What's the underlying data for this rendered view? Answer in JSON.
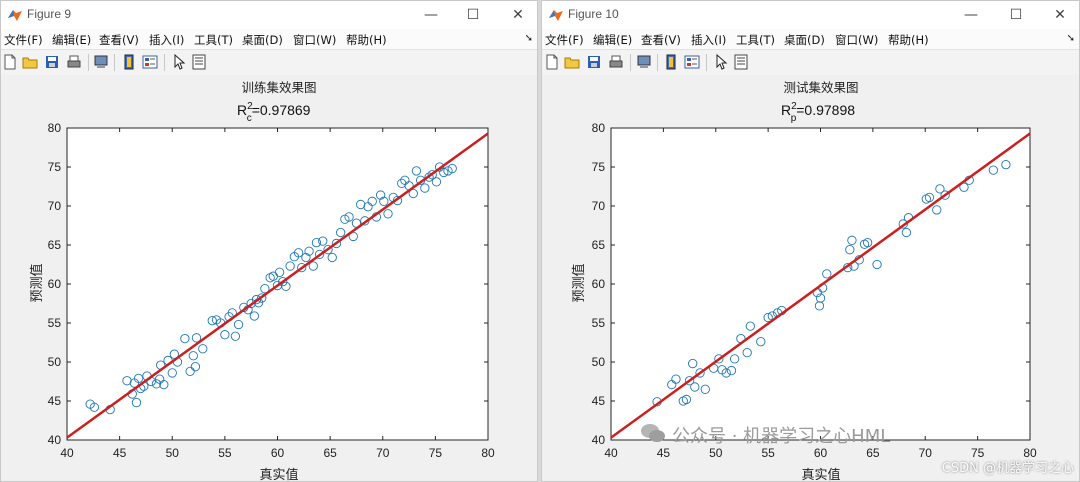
{
  "windows": [
    {
      "title": "Figure 9",
      "menu": [
        "文件(F)",
        "编辑(E)",
        "查看(V)",
        "插入(I)",
        "工具(T)",
        "桌面(D)",
        "窗口(W)",
        "帮助(H)"
      ],
      "plot": {
        "title": "训练集效果图",
        "metric_main": "R",
        "metric_sup": "2",
        "metric_sub": "c",
        "metric_value": "=0.97869",
        "xlabel": "真实值",
        "ylabel": "预测值"
      }
    },
    {
      "title": "Figure 10",
      "menu": [
        "文件(F)",
        "编辑(E)",
        "查看(V)",
        "插入(I)",
        "工具(T)",
        "桌面(D)",
        "窗口(W)",
        "帮助(H)"
      ],
      "plot": {
        "title": "测试集效果图",
        "metric_main": "R",
        "metric_sup": "2",
        "metric_sub": "p",
        "metric_value": "=0.97898",
        "xlabel": "真实值",
        "ylabel": "预测值"
      }
    }
  ],
  "watermark": "公众号 · 机器学习之心HML",
  "credit": "CSDN @机器学习之心",
  "colors": {
    "marker": "#1f77b4",
    "fit_line": "#cc1f1f",
    "axes_bg": "#ffffff"
  },
  "icons": [
    "new-file-icon",
    "open-folder-icon",
    "save-icon",
    "print-icon",
    "print-preview-icon",
    "link-plot-icon",
    "property-inspector-icon",
    "pointer-icon",
    "edit-plot-icon"
  ],
  "chart_data": [
    {
      "type": "scatter",
      "title": "训练集效果图",
      "annotation": "Rc²=0.97869",
      "xlabel": "真实值",
      "ylabel": "预测值",
      "xlim": [
        40,
        80
      ],
      "ylim": [
        40,
        80
      ],
      "xticks": [
        40,
        45,
        50,
        55,
        60,
        65,
        70,
        75,
        80
      ],
      "yticks": [
        40,
        45,
        50,
        55,
        60,
        65,
        70,
        75,
        80
      ],
      "grid": false,
      "fit_line": [
        [
          40,
          40.3
        ],
        [
          80,
          79.3
        ]
      ],
      "points": [
        [
          42.2,
          44.6
        ],
        [
          42.6,
          44.2
        ],
        [
          44.1,
          43.9
        ],
        [
          45.7,
          47.6
        ],
        [
          46.2,
          45.9
        ],
        [
          46.4,
          47.3
        ],
        [
          46.6,
          44.8
        ],
        [
          46.8,
          47.9
        ],
        [
          47.0,
          46.6
        ],
        [
          47.3,
          46.9
        ],
        [
          47.6,
          48.2
        ],
        [
          48.0,
          47.5
        ],
        [
          48.5,
          47.2
        ],
        [
          48.8,
          47.8
        ],
        [
          48.9,
          49.6
        ],
        [
          49.2,
          47.1
        ],
        [
          49.6,
          50.2
        ],
        [
          50.0,
          48.6
        ],
        [
          50.2,
          51.0
        ],
        [
          50.5,
          50.0
        ],
        [
          51.2,
          53.0
        ],
        [
          51.7,
          48.8
        ],
        [
          52.0,
          50.8
        ],
        [
          52.2,
          49.4
        ],
        [
          52.3,
          53.1
        ],
        [
          52.9,
          51.7
        ],
        [
          53.8,
          55.3
        ],
        [
          54.2,
          55.4
        ],
        [
          54.6,
          55.0
        ],
        [
          55.0,
          53.5
        ],
        [
          55.4,
          55.8
        ],
        [
          55.7,
          56.3
        ],
        [
          56.0,
          53.3
        ],
        [
          56.3,
          54.8
        ],
        [
          56.8,
          57.0
        ],
        [
          57.2,
          56.7
        ],
        [
          57.5,
          57.5
        ],
        [
          57.8,
          55.9
        ],
        [
          58.0,
          58.0
        ],
        [
          58.2,
          57.6
        ],
        [
          58.5,
          58.2
        ],
        [
          58.8,
          59.4
        ],
        [
          59.3,
          60.8
        ],
        [
          59.6,
          61.0
        ],
        [
          60.0,
          59.8
        ],
        [
          60.2,
          61.5
        ],
        [
          60.5,
          60.3
        ],
        [
          60.8,
          59.7
        ],
        [
          61.2,
          62.3
        ],
        [
          61.6,
          63.5
        ],
        [
          62.0,
          64.0
        ],
        [
          62.3,
          62.1
        ],
        [
          62.7,
          63.4
        ],
        [
          63.0,
          64.2
        ],
        [
          63.4,
          62.3
        ],
        [
          63.7,
          65.3
        ],
        [
          64.0,
          63.8
        ],
        [
          64.3,
          65.5
        ],
        [
          64.8,
          64.4
        ],
        [
          65.2,
          63.4
        ],
        [
          65.6,
          65.2
        ],
        [
          66.0,
          66.6
        ],
        [
          66.4,
          68.3
        ],
        [
          66.8,
          68.6
        ],
        [
          67.2,
          66.1
        ],
        [
          67.5,
          67.8
        ],
        [
          67.9,
          70.2
        ],
        [
          68.3,
          68.1
        ],
        [
          68.6,
          69.9
        ],
        [
          69.0,
          70.6
        ],
        [
          69.4,
          68.6
        ],
        [
          69.8,
          71.4
        ],
        [
          70.1,
          70.6
        ],
        [
          70.5,
          69.0
        ],
        [
          71.0,
          71.1
        ],
        [
          71.4,
          70.7
        ],
        [
          71.8,
          72.9
        ],
        [
          72.1,
          73.3
        ],
        [
          72.5,
          72.6
        ],
        [
          72.9,
          71.6
        ],
        [
          73.2,
          74.5
        ],
        [
          73.6,
          73.3
        ],
        [
          74.0,
          72.3
        ],
        [
          74.4,
          73.7
        ],
        [
          74.7,
          74.0
        ],
        [
          75.1,
          73.1
        ],
        [
          75.4,
          75.0
        ],
        [
          75.8,
          74.3
        ],
        [
          76.2,
          74.5
        ],
        [
          76.6,
          74.8
        ]
      ]
    },
    {
      "type": "scatter",
      "title": "测试集效果图",
      "annotation": "Rp²=0.97898",
      "xlabel": "真实值",
      "ylabel": "预测值",
      "xlim": [
        40,
        80
      ],
      "ylim": [
        40,
        80
      ],
      "xticks": [
        40,
        45,
        50,
        55,
        60,
        65,
        70,
        75,
        80
      ],
      "yticks": [
        40,
        45,
        50,
        55,
        60,
        65,
        70,
        75,
        80
      ],
      "grid": false,
      "fit_line": [
        [
          40,
          40.3
        ],
        [
          80,
          79.3
        ]
      ],
      "points": [
        [
          44.4,
          44.9
        ],
        [
          45.8,
          47.1
        ],
        [
          46.2,
          47.8
        ],
        [
          46.9,
          45.0
        ],
        [
          47.2,
          45.2
        ],
        [
          47.5,
          47.6
        ],
        [
          47.8,
          49.8
        ],
        [
          48.0,
          46.8
        ],
        [
          48.5,
          48.6
        ],
        [
          49.0,
          46.5
        ],
        [
          49.8,
          49.2
        ],
        [
          50.3,
          50.4
        ],
        [
          50.6,
          49.0
        ],
        [
          51.0,
          48.6
        ],
        [
          51.5,
          48.9
        ],
        [
          51.8,
          50.4
        ],
        [
          52.4,
          53.0
        ],
        [
          53.0,
          51.2
        ],
        [
          53.3,
          54.6
        ],
        [
          54.3,
          52.6
        ],
        [
          55.0,
          55.7
        ],
        [
          55.4,
          55.9
        ],
        [
          55.9,
          56.3
        ],
        [
          56.3,
          56.6
        ],
        [
          59.7,
          58.9
        ],
        [
          59.9,
          57.2
        ],
        [
          60.0,
          58.2
        ],
        [
          60.2,
          59.5
        ],
        [
          60.6,
          61.3
        ],
        [
          62.6,
          62.1
        ],
        [
          62.8,
          64.4
        ],
        [
          63.0,
          65.6
        ],
        [
          63.2,
          62.3
        ],
        [
          63.7,
          63.1
        ],
        [
          64.2,
          65.1
        ],
        [
          64.5,
          65.3
        ],
        [
          65.4,
          62.5
        ],
        [
          67.9,
          67.7
        ],
        [
          68.2,
          66.6
        ],
        [
          68.4,
          68.5
        ],
        [
          70.1,
          70.9
        ],
        [
          70.4,
          71.1
        ],
        [
          71.1,
          69.5
        ],
        [
          71.4,
          72.2
        ],
        [
          71.9,
          71.4
        ],
        [
          73.7,
          72.4
        ],
        [
          74.2,
          73.3
        ],
        [
          76.5,
          74.6
        ],
        [
          77.7,
          75.3
        ]
      ]
    }
  ]
}
